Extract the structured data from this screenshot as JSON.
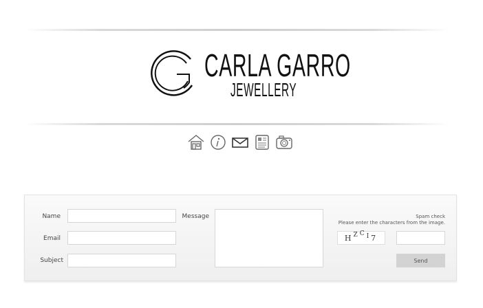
{
  "brand": {
    "name": "CARLA GARRO",
    "subtitle": "JEWELLERY"
  },
  "nav": {
    "icons": [
      "home-icon",
      "info-icon",
      "mail-icon",
      "news-icon",
      "camera-icon"
    ]
  },
  "form": {
    "name_label": "Name",
    "email_label": "Email",
    "subject_label": "Subject",
    "message_label": "Message",
    "name_value": "",
    "email_value": "",
    "subject_value": "",
    "message_value": "",
    "spam_title": "Spam check",
    "spam_help": "Please enter the characters from the image.",
    "captcha": [
      "H",
      "Z",
      "C",
      "I",
      "7"
    ],
    "captcha_value": "",
    "send_label": "Send"
  }
}
